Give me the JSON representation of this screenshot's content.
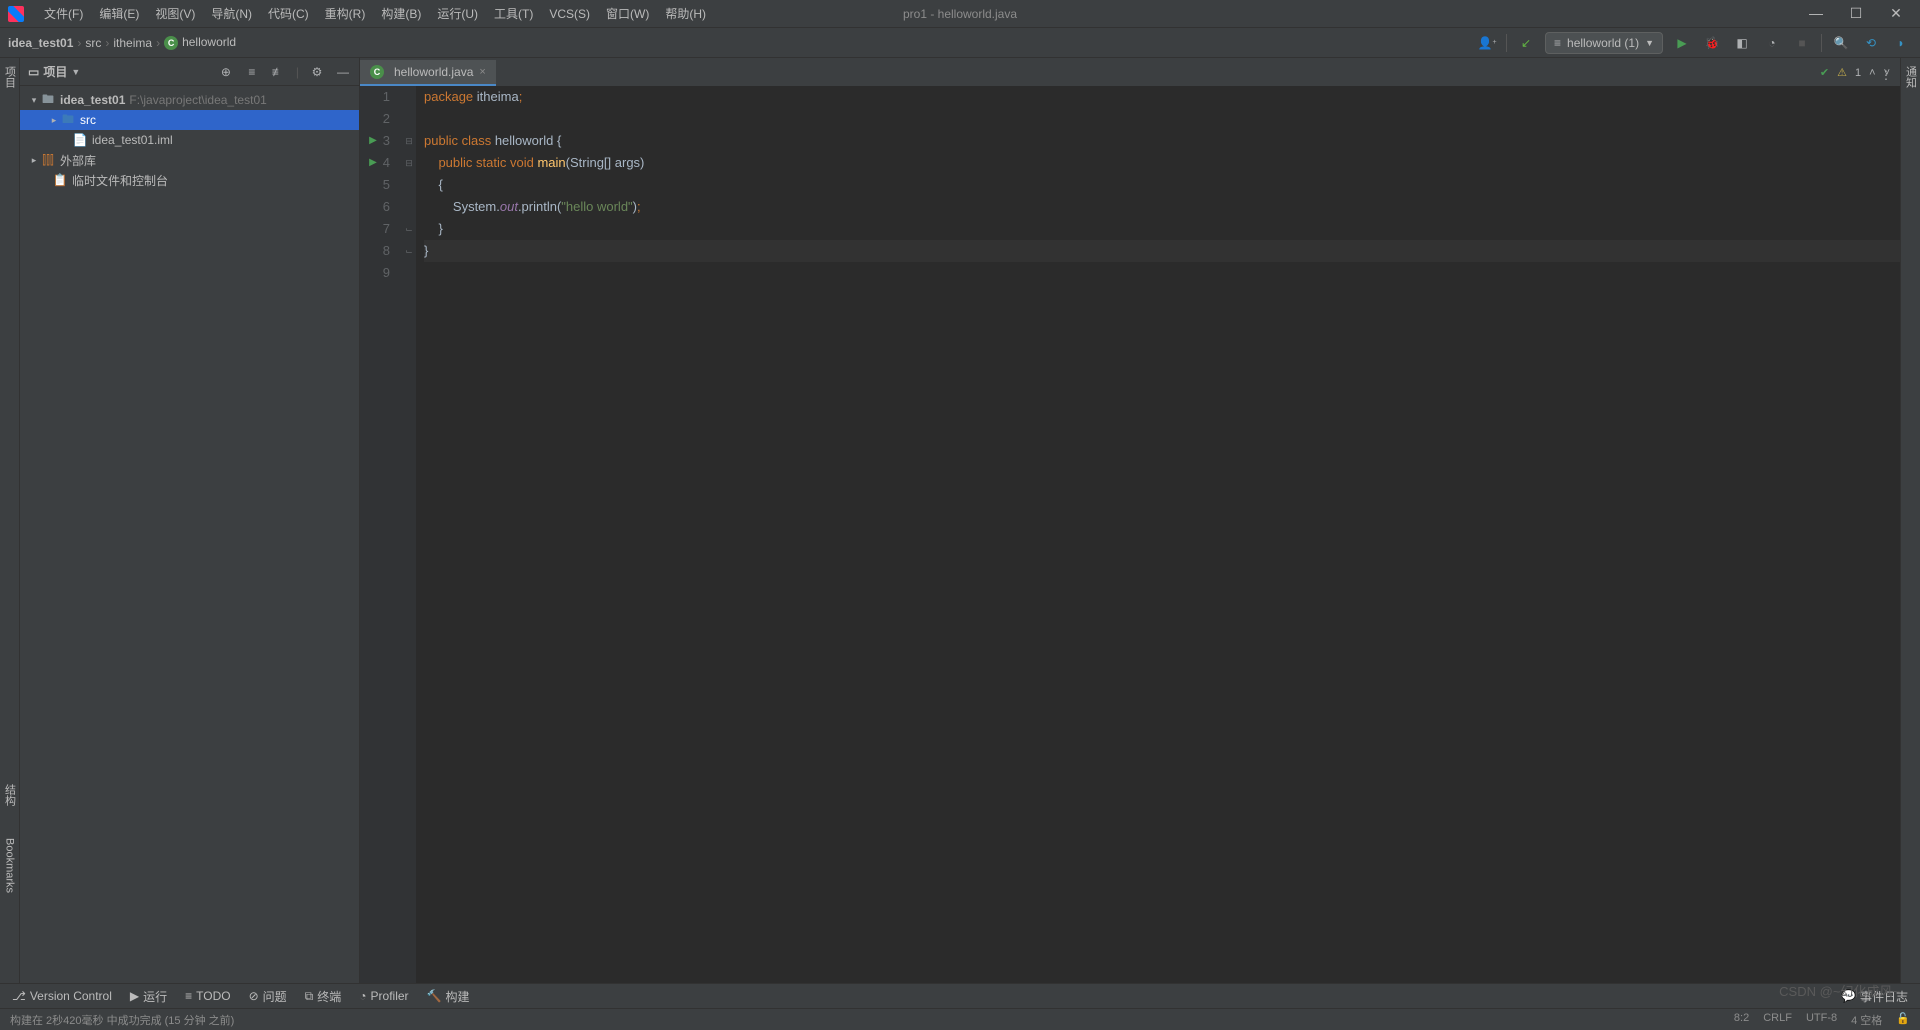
{
  "title": "pro1 - helloworld.java",
  "menu": [
    "文件(F)",
    "编辑(E)",
    "视图(V)",
    "导航(N)",
    "代码(C)",
    "重构(R)",
    "构建(B)",
    "运行(U)",
    "工具(T)",
    "VCS(S)",
    "窗口(W)",
    "帮助(H)"
  ],
  "breadcrumb": {
    "project": "idea_test01",
    "src": "src",
    "pkg": "itheima",
    "cls": "helloworld"
  },
  "runConfig": "helloworld (1)",
  "panel": {
    "title": "项目"
  },
  "tree": {
    "root": "idea_test01",
    "rootPath": "F:\\javaproject\\idea_test01",
    "src": "src",
    "iml": "idea_test01.iml",
    "extlib": "外部库",
    "scratch": "临时文件和控制台"
  },
  "tab": "helloworld.java",
  "lines": [
    "1",
    "2",
    "3",
    "4",
    "5",
    "6",
    "7",
    "8",
    "9"
  ],
  "editorStatus": {
    "warn": "1"
  },
  "bottom": {
    "vcs": "Version Control",
    "run": "运行",
    "todo": "TODO",
    "problems": "问题",
    "terminal": "终端",
    "profiler": "Profiler",
    "build": "构建",
    "log": "事件日志"
  },
  "status": {
    "build": "构建在 2秒420毫秒 中成功完成 (15 分钟 之前)",
    "pos": "8:2",
    "crlf": "CRLF",
    "enc": "UTF-8",
    "spaces": "4 空格"
  },
  "leftGutter": {
    "project": "项目",
    "structure": "结构",
    "bookmarks": "Bookmarks"
  },
  "rightGutter": {
    "notif": "通知"
  },
  "watermark": "CSDN @~幻化成风~"
}
